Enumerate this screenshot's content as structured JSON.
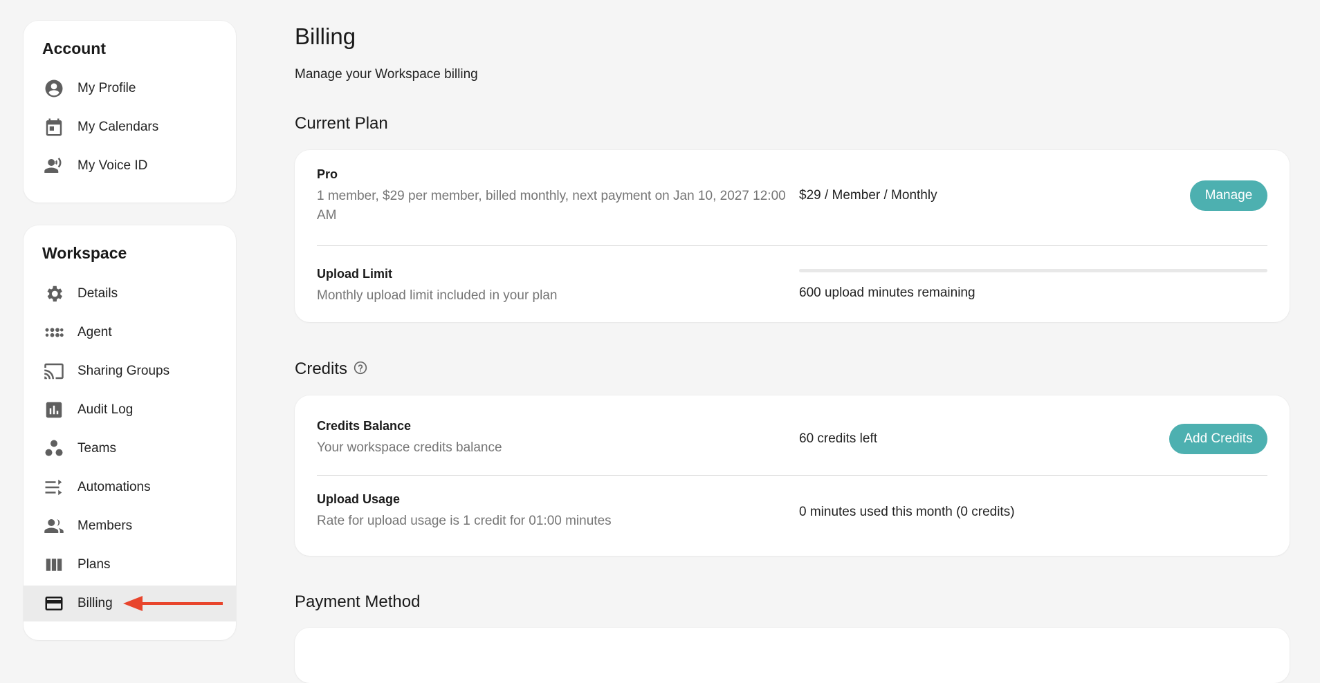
{
  "sidebar": {
    "account": {
      "title": "Account",
      "items": [
        {
          "label": "My Profile",
          "icon": "account-circle-icon"
        },
        {
          "label": "My Calendars",
          "icon": "calendar-icon"
        },
        {
          "label": "My Voice ID",
          "icon": "voice-id-icon"
        }
      ]
    },
    "workspace": {
      "title": "Workspace",
      "items": [
        {
          "label": "Details",
          "icon": "gear-icon"
        },
        {
          "label": "Agent",
          "icon": "agent-icon"
        },
        {
          "label": "Sharing Groups",
          "icon": "cast-icon"
        },
        {
          "label": "Audit Log",
          "icon": "bar-chart-icon"
        },
        {
          "label": "Teams",
          "icon": "teams-icon"
        },
        {
          "label": "Automations",
          "icon": "automation-icon"
        },
        {
          "label": "Members",
          "icon": "members-icon"
        },
        {
          "label": "Plans",
          "icon": "columns-icon"
        },
        {
          "label": "Billing",
          "icon": "credit-card-icon",
          "active": true
        }
      ]
    }
  },
  "main": {
    "title": "Billing",
    "subtitle": "Manage your Workspace billing",
    "current_plan": {
      "heading": "Current Plan",
      "plan_name": "Pro",
      "plan_desc": "1 member, $29 per member, billed monthly, next payment on Jan 10, 2027 12:00 AM",
      "price": "$29 / Member / Monthly",
      "manage_label": "Manage",
      "upload_title": "Upload Limit",
      "upload_desc": "Monthly upload limit included in your plan",
      "upload_remaining": "600 upload minutes remaining",
      "upload_used_fraction": 0
    },
    "credits": {
      "heading": "Credits",
      "balance_title": "Credits Balance",
      "balance_desc": "Your workspace credits balance",
      "balance_value": "60 credits left",
      "add_label": "Add Credits",
      "usage_title": "Upload Usage",
      "usage_desc": "Rate for upload usage is 1 credit for 01:00 minutes",
      "usage_value": "0 minutes used this month (0 credits)"
    },
    "payment": {
      "heading": "Payment Method"
    }
  },
  "colors": {
    "accent": "#4db0b0",
    "annotation_arrow": "#e8452c",
    "background": "#f5f5f5"
  }
}
